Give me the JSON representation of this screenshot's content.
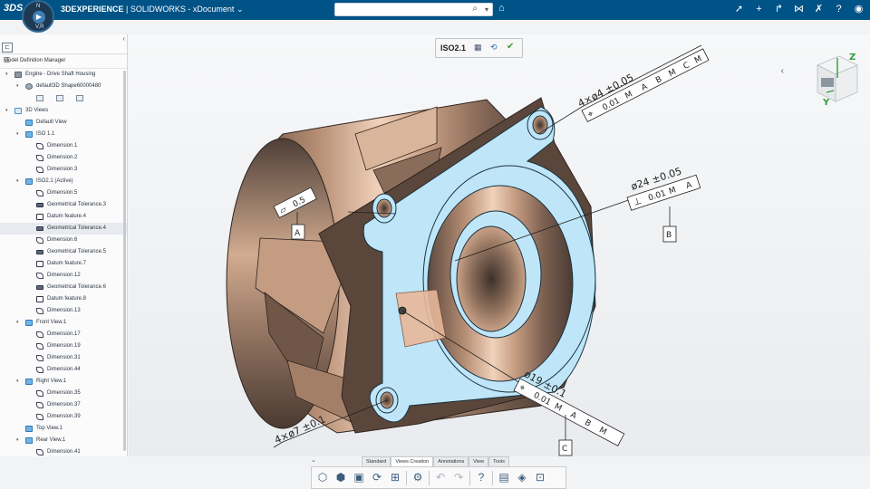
{
  "topbar": {
    "logo": "3DS",
    "brand": "3DEXPERIENCE",
    "separator": "|",
    "app": "SOLIDWORKS - xDocument",
    "app_chevron": "chevron-down-icon",
    "search_placeholder": "",
    "compass_n": "N",
    "compass_vr": "V,R",
    "right_icons": [
      "share-pointer-icon",
      "add-icon",
      "share-arrow-icon",
      "network-icon",
      "tools-icon",
      "help-icon",
      "user-icon"
    ]
  },
  "panel": {
    "title": "Model Definition Manager",
    "tree": [
      {
        "level": 0,
        "expand": "▾",
        "icon": "part",
        "label": "Engine - Drive Shaft Housing"
      },
      {
        "level": 1,
        "expand": "▾",
        "icon": "shape",
        "label": "default3D Shape60000480"
      },
      {
        "level": 0,
        "expand": "▾",
        "icon": "views",
        "label": "3D Views"
      },
      {
        "level": 1,
        "expand": "",
        "icon": "view",
        "label": "Default View"
      },
      {
        "level": 1,
        "expand": "▾",
        "icon": "view",
        "label": "ISO 1.1"
      },
      {
        "level": 2,
        "expand": "",
        "icon": "dim",
        "label": "Dimension.1"
      },
      {
        "level": 2,
        "expand": "",
        "icon": "dim",
        "label": "Dimension.2"
      },
      {
        "level": 2,
        "expand": "",
        "icon": "dim",
        "label": "Dimension.3"
      },
      {
        "level": 1,
        "expand": "▾",
        "icon": "view",
        "label": "ISO2.1 (Active)"
      },
      {
        "level": 2,
        "expand": "",
        "icon": "dim",
        "label": "Dimension.5"
      },
      {
        "level": 2,
        "expand": "",
        "icon": "gtol",
        "label": "Geometrical Tolerance.3"
      },
      {
        "level": 2,
        "expand": "",
        "icon": "datum",
        "label": "Datum feature.4"
      },
      {
        "level": 2,
        "expand": "",
        "icon": "gtol",
        "label": "Geometrical Tolerance.4",
        "hover": true
      },
      {
        "level": 2,
        "expand": "",
        "icon": "dim",
        "label": "Dimension.6"
      },
      {
        "level": 2,
        "expand": "",
        "icon": "gtol",
        "label": "Geometrical Tolerance.5"
      },
      {
        "level": 2,
        "expand": "",
        "icon": "datum",
        "label": "Datum feature.7"
      },
      {
        "level": 2,
        "expand": "",
        "icon": "dim",
        "label": "Dimension.12"
      },
      {
        "level": 2,
        "expand": "",
        "icon": "gtol",
        "label": "Geometrical Tolerance.6"
      },
      {
        "level": 2,
        "expand": "",
        "icon": "datum",
        "label": "Datum feature.8"
      },
      {
        "level": 2,
        "expand": "",
        "icon": "dim",
        "label": "Dimension.13"
      },
      {
        "level": 1,
        "expand": "▾",
        "icon": "view",
        "label": "Front View.1"
      },
      {
        "level": 2,
        "expand": "",
        "icon": "dim",
        "label": "Dimension.17"
      },
      {
        "level": 2,
        "expand": "",
        "icon": "dim",
        "label": "Dimension.19"
      },
      {
        "level": 2,
        "expand": "",
        "icon": "dim",
        "label": "Dimension.31"
      },
      {
        "level": 2,
        "expand": "",
        "icon": "dim",
        "label": "Dimension.44"
      },
      {
        "level": 1,
        "expand": "▾",
        "icon": "view",
        "label": "Right View.1"
      },
      {
        "level": 2,
        "expand": "",
        "icon": "dim",
        "label": "Dimension.35"
      },
      {
        "level": 2,
        "expand": "",
        "icon": "dim",
        "label": "Dimension.37"
      },
      {
        "level": 2,
        "expand": "",
        "icon": "dim",
        "label": "Dimension.39"
      },
      {
        "level": 1,
        "expand": "",
        "icon": "view",
        "label": "Top View.1"
      },
      {
        "level": 1,
        "expand": "▾",
        "icon": "view",
        "label": "Rear View.1"
      },
      {
        "level": 2,
        "expand": "",
        "icon": "dim",
        "label": "Dimension.41"
      }
    ]
  },
  "viewport": {
    "active_view": "ISO2.1",
    "annotations": {
      "holes_top": "4×ø4 ±0.05",
      "fcf1_tol": "0.01",
      "fcf1_datums": [
        "A",
        "B",
        "C"
      ],
      "flatness": "0.5",
      "datum_a": "A",
      "bore": "ø24 ±0.05",
      "fcf2_tol": "0.01",
      "fcf2_datum": "A",
      "datum_b": "B",
      "bore2": "ø19 ±0.1",
      "fcf3_tol": "0.01",
      "fcf3_datums": [
        "A",
        "B"
      ],
      "datum_c": "C",
      "holes_bottom": "4×ø7 ±0.1",
      "mmc": "M"
    },
    "axes": {
      "z": "Z",
      "y": "Y"
    },
    "colors": {
      "face_highlight": "#bfe6f8",
      "metal": "#9c7a64"
    }
  },
  "actionbar": {
    "tabs": [
      "Standard",
      "Views Creation",
      "Annotations",
      "View",
      "Tools"
    ],
    "active_tab": "Views Creation",
    "tools": [
      "view-icon",
      "capture-icon",
      "save-icon",
      "update-icon",
      "annotation-icon",
      "settings-icon",
      "undo-icon",
      "redo-icon",
      "help-icon",
      "display-icon",
      "cube-icon",
      "fit-icon"
    ]
  }
}
